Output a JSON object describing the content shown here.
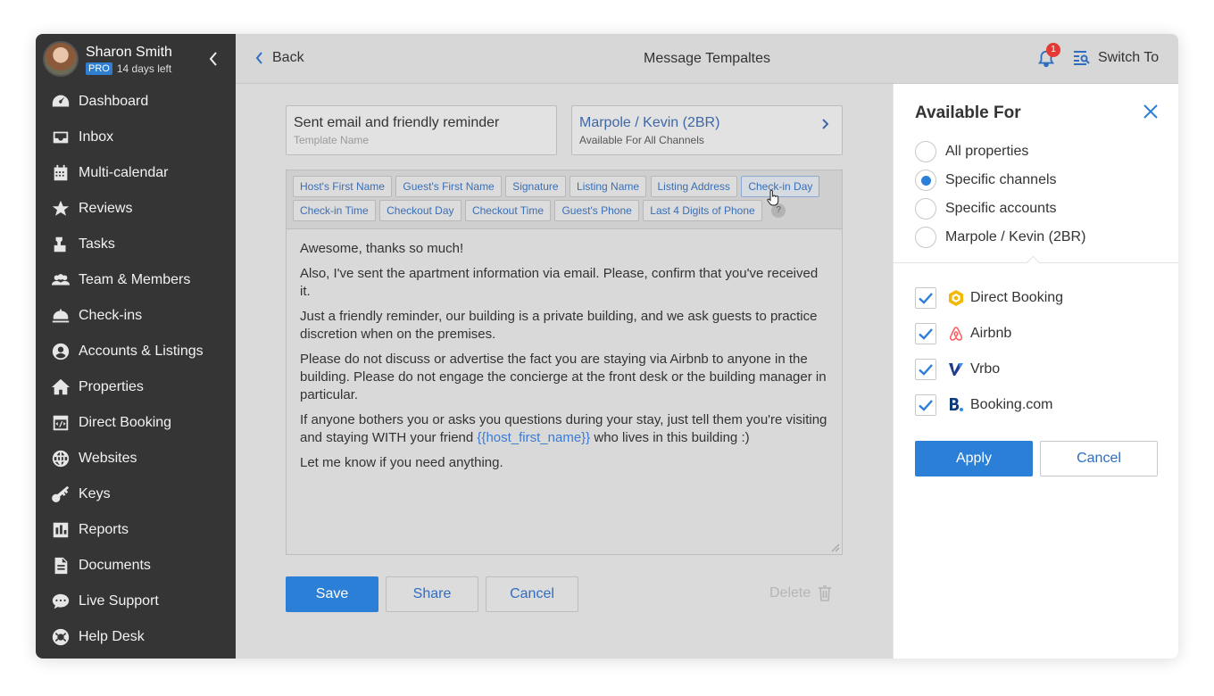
{
  "user": {
    "name": "Sharon Smith",
    "plan_badge": "PRO",
    "trial": "14 days left"
  },
  "sidebar": {
    "items": [
      {
        "label": "Dashboard",
        "icon": "dashboard-icon"
      },
      {
        "label": "Inbox",
        "icon": "inbox-icon"
      },
      {
        "label": "Multi-calendar",
        "icon": "calendar-icon"
      },
      {
        "label": "Reviews",
        "icon": "star-icon"
      },
      {
        "label": "Tasks",
        "icon": "tasks-icon"
      },
      {
        "label": "Team & Members",
        "icon": "team-icon"
      },
      {
        "label": "Check-ins",
        "icon": "bell-desk-icon"
      },
      {
        "label": "Accounts & Listings",
        "icon": "account-icon"
      },
      {
        "label": "Properties",
        "icon": "home-icon"
      },
      {
        "label": "Direct Booking",
        "icon": "direct-booking-icon"
      },
      {
        "label": "Websites",
        "icon": "globe-icon"
      },
      {
        "label": "Keys",
        "icon": "key-icon"
      },
      {
        "label": "Reports",
        "icon": "reports-icon"
      },
      {
        "label": "Documents",
        "icon": "document-icon"
      },
      {
        "label": "Live Support",
        "icon": "chat-icon"
      },
      {
        "label": "Help Desk",
        "icon": "lifebuoy-icon"
      }
    ]
  },
  "header": {
    "back_label": "Back",
    "title": "Message Tempaltes",
    "notification_count": "1",
    "switch_label": "Switch To"
  },
  "template": {
    "name_value": "Sent email and friendly reminder",
    "name_label": "Template Name",
    "availability_value": "Marpole / Kevin (2BR)",
    "availability_label": "Available For All Channels"
  },
  "tags": {
    "row1": [
      "Host's First Name",
      "Guest's First Name",
      "Signature",
      "Listing Name",
      "Listing Address",
      "Check-in Day"
    ],
    "row2": [
      "Check-in Time",
      "Checkout Day",
      "Checkout Time",
      "Guest's Phone",
      "Last 4 Digits of Phone"
    ],
    "help": "?"
  },
  "message": {
    "p1": "Awesome, thanks so much!",
    "p2": "Also, I've sent the apartment information via email. Please, confirm that you've received it.",
    "p3": "Just a friendly reminder, our building is a private building, and we ask guests to practice discretion when on the premises.",
    "p4": "Please do not discuss or advertise the fact you are staying via Airbnb to anyone in the building. Please do not engage the concierge at the front desk or the building manager in particular.",
    "p5_before": "If anyone bothers you or asks you questions during your stay, just tell them you're visiting and staying WITH your friend ",
    "p5_var": "{{host_first_name}}",
    "p5_after": " who lives in this building :)",
    "p6": "Let me know if you need anything."
  },
  "actions": {
    "save": "Save",
    "share": "Share",
    "cancel": "Cancel",
    "delete": "Delete"
  },
  "panel": {
    "title": "Available For",
    "scope_options": [
      {
        "label": "All properties",
        "selected": false
      },
      {
        "label": "Specific channels",
        "selected": true
      },
      {
        "label": "Specific accounts",
        "selected": false
      },
      {
        "label": "Marpole / Kevin (2BR)",
        "selected": false
      }
    ],
    "channels": [
      {
        "label": "Direct Booking",
        "checked": true,
        "icon": "direct-booking-icon"
      },
      {
        "label": "Airbnb",
        "checked": true,
        "icon": "airbnb-icon"
      },
      {
        "label": "Vrbo",
        "checked": true,
        "icon": "vrbo-icon"
      },
      {
        "label": "Booking.com",
        "checked": true,
        "icon": "booking-com-icon"
      }
    ],
    "apply": "Apply",
    "cancel": "Cancel"
  },
  "colors": {
    "accent": "#2b7fd6",
    "sidebar_bg": "#353535",
    "badge": "#e53935"
  }
}
